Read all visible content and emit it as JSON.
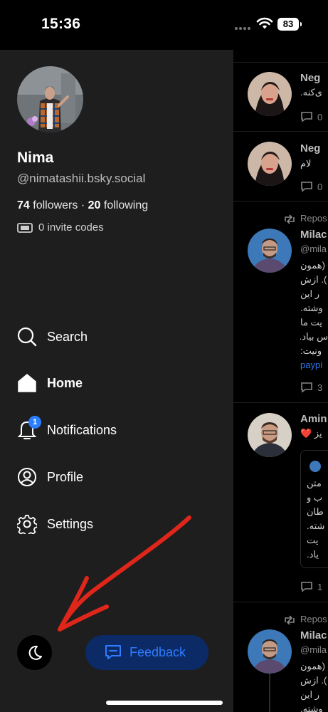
{
  "status_bar": {
    "time": "15:36",
    "battery": "83"
  },
  "drawer": {
    "name": "Nima",
    "handle": "@nimatashii.bsky.social",
    "followers_count": "74",
    "followers_label": "followers",
    "separator": "·",
    "following_count": "20",
    "following_label": "following",
    "invite_codes": "0 invite codes",
    "nav": [
      {
        "label": "Search",
        "icon": "search-icon"
      },
      {
        "label": "Home",
        "icon": "home-icon",
        "active": true
      },
      {
        "label": "Notifications",
        "icon": "bell-icon",
        "badge": "1"
      },
      {
        "label": "Profile",
        "icon": "user-circle-icon"
      },
      {
        "label": "Settings",
        "icon": "gear-icon"
      }
    ],
    "theme_toggle_icon": "moon-icon",
    "feedback_label": "Feedback",
    "feedback_icon": "chat-bubble-icon"
  },
  "feed": {
    "posts": [
      {
        "name": "Neg",
        "handle": "@",
        "text": [
          "ی‌کنه."
        ],
        "reply_count": "0"
      },
      {
        "name": "Neg",
        "text": [
          "لام"
        ],
        "reply_count": "0"
      },
      {
        "repost_label": "Repos",
        "name": "Milac",
        "handle": "@mila",
        "text": [
          "(همون",
          "). ازش",
          "ر این",
          "وشته.",
          "یت ما",
          "س بیاد.",
          "ونیت:"
        ],
        "link": "paypi",
        "reply_count": "3"
      },
      {
        "name": "Amin",
        "text": [
          "یز ❤️"
        ],
        "quote_text": [
          "متن",
          "ب و",
          "طان",
          "شته.",
          "یت",
          "یاد."
        ],
        "reply_count": "1"
      },
      {
        "repost_label": "Repos",
        "name": "Milac",
        "handle": "@mila",
        "text": [
          "(همون",
          "). ازش",
          "ر این",
          "وشته."
        ]
      }
    ]
  },
  "colors": {
    "accent": "#2b7fff",
    "drawer_bg": "#1e1e1e",
    "annotation_arrow": "#e0261b"
  }
}
